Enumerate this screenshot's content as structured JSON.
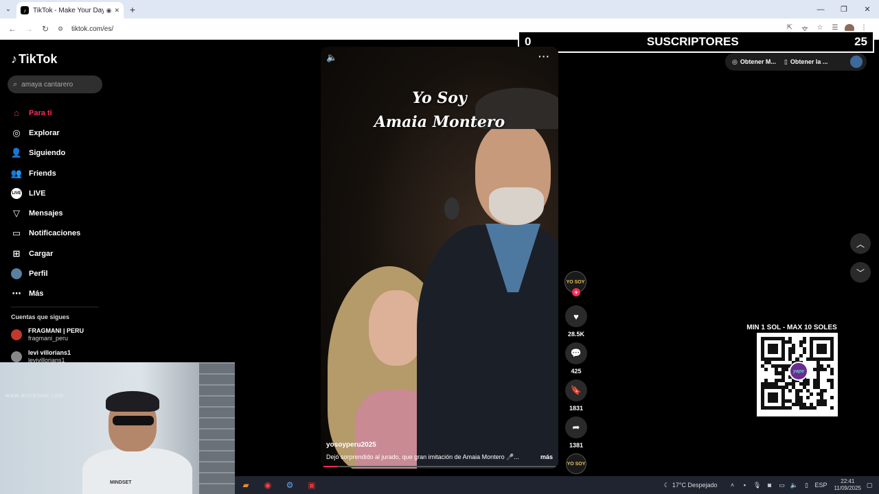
{
  "browser": {
    "tab_title": "TikTok - Make Your Day",
    "url": "tiktok.com/es/"
  },
  "overlay": {
    "count_left": "0",
    "label": "SUSCRIPTORES",
    "count_right": "25"
  },
  "sidebar": {
    "logo": "TikTok",
    "search_placeholder": "amaya cantarero",
    "items": [
      {
        "label": "Para ti"
      },
      {
        "label": "Explorar"
      },
      {
        "label": "Siguiendo"
      },
      {
        "label": "Friends"
      },
      {
        "label": "LIVE"
      },
      {
        "label": "Mensajes"
      },
      {
        "label": "Notificaciones"
      },
      {
        "label": "Cargar"
      },
      {
        "label": "Perfil"
      },
      {
        "label": "Más"
      }
    ],
    "following_title": "Cuentas que sigues",
    "accounts": [
      {
        "name": "FRAGMANI | PERU",
        "handle": "fragmani_peru"
      },
      {
        "name": "levi villorians1",
        "handle": "levivillorians1"
      }
    ]
  },
  "webcam": {
    "watermark": "www.bricklook.com",
    "shirt_brand": "MINDSET"
  },
  "video": {
    "title_line1": "Yo Soy",
    "title_line2": "Amaia Montero",
    "author": "yosoyperu2025",
    "description": "Dejó sorprendido al jurado, que gran imitación de Amaia Montero 🎤...",
    "more_label": "más",
    "progress": 0.06
  },
  "actions": {
    "avatar_text": "YO SOY",
    "likes": "28.5K",
    "comments": "425",
    "saves": "1831",
    "shares": "1381"
  },
  "right": {
    "get_app1": "Obtener M...",
    "get_app2": "Obtener la ..."
  },
  "qr": {
    "label": "MIN 1 SOL - MAX 10 SOLES",
    "logo_text": "yape"
  },
  "taskbar": {
    "weather": "17°C Despejado",
    "lang": "ESP",
    "time": "22:41",
    "date": "11/09/2025"
  },
  "colors": {
    "accent": "#fe2c55",
    "background": "#000000"
  }
}
